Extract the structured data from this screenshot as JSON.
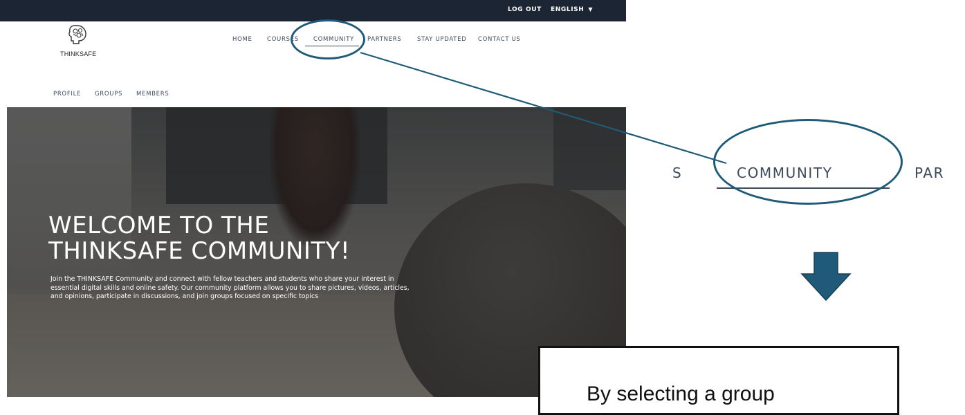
{
  "topbar": {
    "logout_label": "LOG OUT",
    "language_label": "ENGLISH"
  },
  "logo": {
    "name": "THINKSAFE",
    "icon": "brain-head-icon"
  },
  "main_nav": {
    "items": [
      {
        "label": "HOME"
      },
      {
        "label": "COURSES"
      },
      {
        "label": "COMMUNITY",
        "active": true
      },
      {
        "label": "PARTNERS"
      },
      {
        "label": "STAY UPDATED"
      },
      {
        "label": "CONTACT US"
      }
    ]
  },
  "sub_nav": {
    "items": [
      {
        "label": "PROFILE"
      },
      {
        "label": "GROUPS"
      },
      {
        "label": "MEMBERS"
      }
    ]
  },
  "hero": {
    "title_line1": "WELCOME TO THE",
    "title_line2": "THINKSAFE COMMUNITY!",
    "description": "Join the THINKSAFE Community and connect with fellow teachers and students who share your interest in essential digital skills and online safety. Our community platform allows you to share pictures, videos, articles, and opinions, participate in discussions, and join groups focused on specific topics"
  },
  "zoom": {
    "left_fragment": "S",
    "label": "COMMUNITY",
    "right_fragment": "PAR"
  },
  "callout": {
    "text": "By selecting a group"
  },
  "colors": {
    "topbar": "#1b2533",
    "annotation": "#1f5b78",
    "nav_text": "#3d4a5c"
  }
}
